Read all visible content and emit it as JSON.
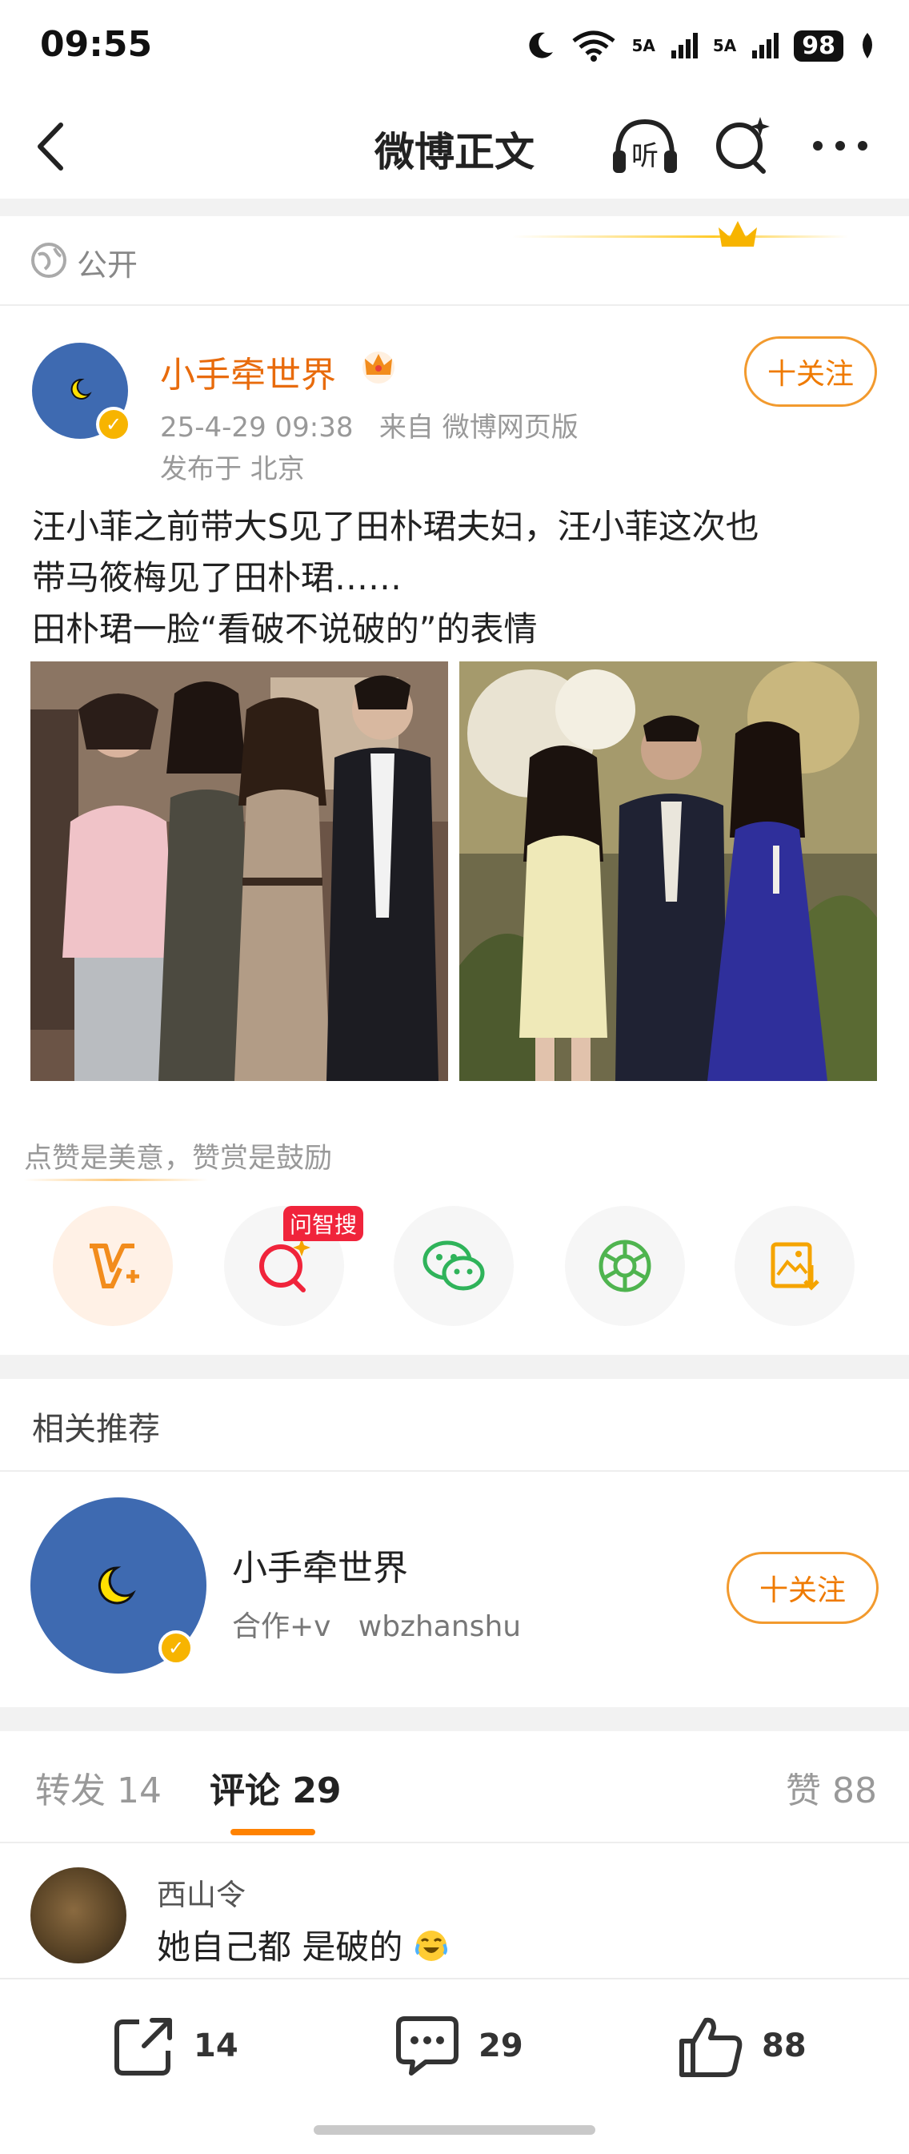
{
  "status_bar": {
    "time": "09:55",
    "network_1": "5A",
    "network_2": "5A",
    "battery": "98"
  },
  "nav": {
    "title": "微博正文",
    "listen_label": "听"
  },
  "visibility": {
    "label": "公开"
  },
  "post": {
    "author": "小手牵世界",
    "meta": "25-4-29 09:38   来自 微博网页版",
    "location": "发布于 北京",
    "follow_label": "十关注",
    "text_line1": "汪小菲之前带大S见了田朴珺夫妇，汪小菲这次也",
    "text_line2": "带马筱梅见了田朴珺……",
    "text_line3": "田朴珺一脸“看破不说破的”的表情"
  },
  "reward": {
    "text": "点赞是美意，赞赏是鼓励",
    "ai_badge": "问智搜"
  },
  "related": {
    "title": "相关推荐",
    "name": "小手牵世界",
    "desc": "合作+v   wbzhanshu",
    "follow_label": "十关注"
  },
  "tabs": {
    "repost": "转发 14",
    "comment": "评论 29",
    "like": "赞 88"
  },
  "comment": {
    "user": "西山令",
    "text": "她自己都 是破的"
  },
  "bottom_bar": {
    "repost_count": "14",
    "comment_count": "29",
    "like_count": "88"
  },
  "colors": {
    "accent_orange": "#ff8200",
    "author_orange": "#e86b0c",
    "verify_gold": "#f7b400",
    "avatar_blue": "#3e6ab1"
  }
}
